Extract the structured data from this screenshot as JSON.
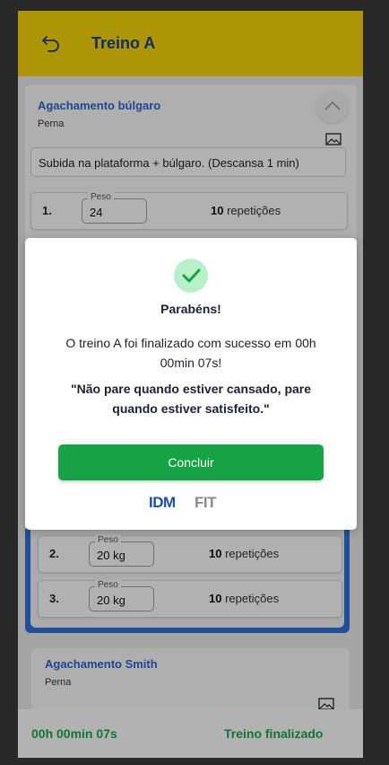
{
  "header": {
    "title": "Treino A"
  },
  "exercise1": {
    "name": "Agachamento búlgaro",
    "group": "Perna",
    "note": "Subida na plataforma + búlgaro. (Descansa 1 min)",
    "sets": [
      {
        "num": "1.",
        "weight_label": "Peso",
        "weight": "24",
        "reps_num": "10",
        "reps_unit": "repetições"
      }
    ]
  },
  "exercise2": {
    "sets": [
      {
        "num": "2.",
        "weight_label": "Peso",
        "weight": "20 kg",
        "reps_num": "10",
        "reps_unit": "repetições"
      },
      {
        "num": "3.",
        "weight_label": "Peso",
        "weight": "20 kg",
        "reps_num": "10",
        "reps_unit": "repetições"
      }
    ]
  },
  "exercise3": {
    "name": "Agachamento Smith",
    "group": "Perna"
  },
  "footer": {
    "timer": "00h 00min 07s",
    "status": "Treino finalizado"
  },
  "modal": {
    "title": "Parabéns!",
    "message": "O treino A foi finalizado com sucesso em 00h 00min 07s!",
    "quote": "\"Não pare quando estiver cansado, pare quando estiver satisfeito.\"",
    "button": "Concluir",
    "logo_text": "IDM FIT"
  },
  "colors": {
    "header_bg": "#f0cf08",
    "title": "#1d3f8f",
    "accent_blue": "#2f6fd6",
    "success_green": "#17a345"
  }
}
